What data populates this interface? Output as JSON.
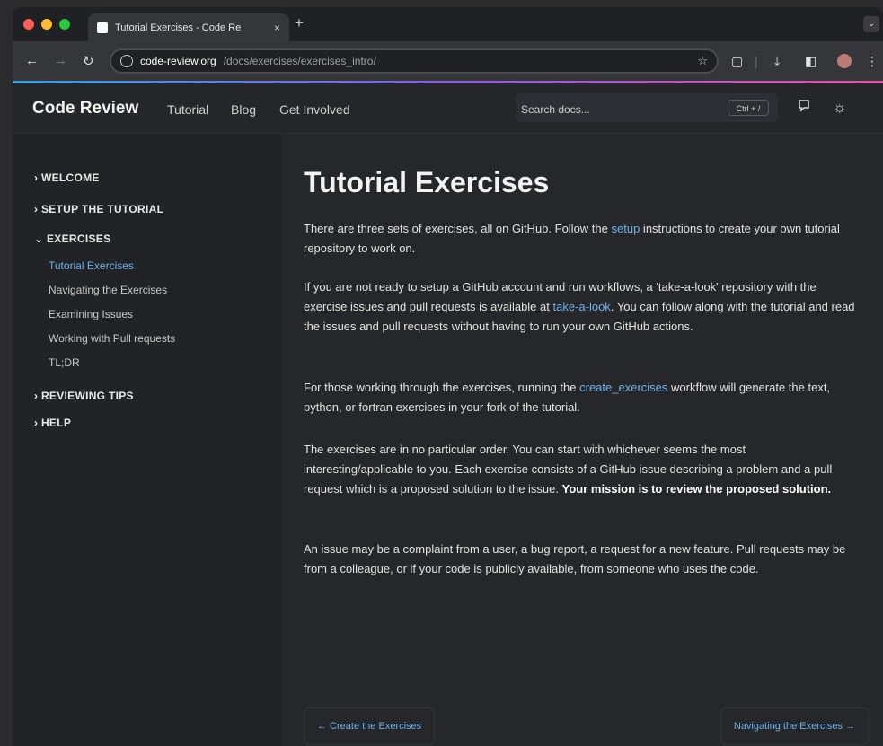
{
  "browser": {
    "tab_title": "Tutorial Exercises - Code Re",
    "tab_close": "×",
    "new_tab": "+",
    "url_host": "code-review.org",
    "url_path": "/docs/exercises/exercises_intro/"
  },
  "site": {
    "brand": "Code Review",
    "nav": [
      "Tutorial",
      "Blog",
      "Get Involved"
    ],
    "search_placeholder": "Search docs...",
    "search_shortcut": "Ctrl + /"
  },
  "sidebar": {
    "sections": [
      {
        "label": "WELCOME",
        "expanded": false
      },
      {
        "label": "SETUP THE TUTORIAL",
        "expanded": false
      },
      {
        "label": "EXERCISES",
        "expanded": true
      },
      {
        "label": "REVIEWING TIPS",
        "expanded": false
      },
      {
        "label": "HELP",
        "expanded": false
      }
    ],
    "exercise_links": [
      "Tutorial Exercises",
      "Navigating the Exercises",
      "Examining Issues",
      "Working with Pull requests",
      "TL;DR"
    ],
    "active_link": "Tutorial Exercises"
  },
  "content": {
    "title": "Tutorial Exercises",
    "p1": {
      "before": "There are three sets of exercises, all on GitHub. Follow the ",
      "link": "setup",
      "after": " instructions to create your own tutorial repository to work on."
    },
    "p2": {
      "before": "If you are not ready to setup a GitHub account and run workflows, a 'take-a-look' repository with the exercise issues and pull requests is available at ",
      "link": "take-a-look",
      "after": ". You can follow along with the tutorial and read the issues and pull requests without having to run your own GitHub actions."
    },
    "p3": {
      "before": "For those working through the exercises, running the ",
      "link": "create_exercises",
      "after": " workflow will generate the text, python, or fortran exercises in your fork of the tutorial."
    },
    "p4": {
      "before": "The exercises are in no particular order. You can start with whichever seems the most interesting/applicable to you. Each exercise consists of a GitHub issue describing a problem and a pull request which is a proposed solution to the issue. ",
      "bold": "Your mission is to review the proposed solution."
    },
    "p5": "An issue may be a complaint from a user, a bug report, a request for a new feature. Pull requests may be from a colleague, or if your code is publicly available, from someone who uses the code.",
    "prev": "← Create the Exercises",
    "next": "Navigating the Exercises →"
  },
  "colors": {
    "link": "#6fb1e8",
    "background": "#26272b",
    "accent_gradient": [
      "#3aa0e0",
      "#8a5fd8",
      "#e056a8"
    ]
  },
  "icons": [
    "github-icon",
    "theme-toggle-icon",
    "download-icon",
    "sidebar-icon",
    "extension-icon",
    "bookmark-star-icon"
  ]
}
